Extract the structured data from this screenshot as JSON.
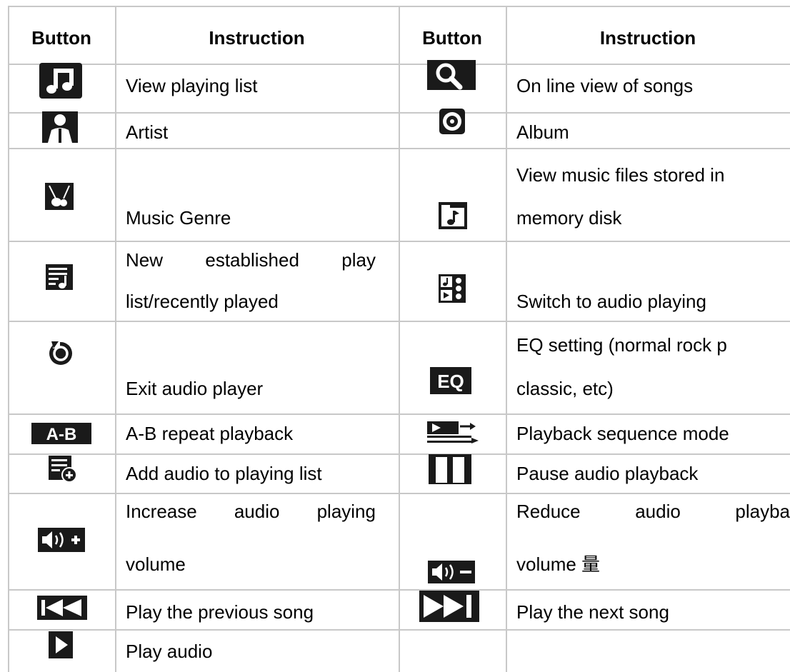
{
  "table": {
    "headers": [
      "Button",
      "Instruction",
      "Button",
      "Instruction"
    ],
    "left": [
      {
        "icon": "music-note-icon",
        "lines": [
          "View playing list"
        ]
      },
      {
        "icon": "artist-icon",
        "lines": [
          "Artist"
        ]
      },
      {
        "icon": "guitar-genre-icon",
        "lines": [
          "Music Genre"
        ]
      },
      {
        "icon": "playlist-new-icon",
        "lines": [
          "New established play",
          "list/recently played"
        ]
      },
      {
        "icon": "exit-icon",
        "lines": [
          "Exit audio player"
        ]
      },
      {
        "icon": "ab-repeat-icon",
        "lines": [
          "A-B repeat playback"
        ]
      },
      {
        "icon": "add-to-list-icon",
        "lines": [
          "Add audio to playing list"
        ]
      },
      {
        "icon": "volume-up-icon",
        "lines": [
          "Increase audio playing",
          "volume"
        ]
      },
      {
        "icon": "previous-icon",
        "lines": [
          "Play the previous song"
        ]
      },
      {
        "icon": "play-icon",
        "lines": [
          "Play audio"
        ]
      }
    ],
    "right": [
      {
        "icon": "search-icon",
        "lines": [
          "On line view of songs"
        ]
      },
      {
        "icon": "album-disc-icon",
        "lines": [
          "Album"
        ]
      },
      {
        "icon": "memory-disk-music-icon",
        "lines": [
          "View music files stored in",
          "memory disk"
        ]
      },
      {
        "icon": "switch-audio-icon",
        "lines": [
          "Switch to audio playing"
        ]
      },
      {
        "icon": "eq-icon",
        "lines": [
          "EQ setting (normal rock p",
          "classic, etc)"
        ]
      },
      {
        "icon": "sequence-mode-icon",
        "lines": [
          "Playback sequence mode"
        ]
      },
      {
        "icon": "pause-icon",
        "lines": [
          "Pause audio playback"
        ]
      },
      {
        "icon": "volume-down-icon",
        "lines": [
          "Reduce audio playba",
          "volume 量"
        ]
      },
      {
        "icon": "next-icon",
        "lines": [
          "Play the next song"
        ]
      }
    ],
    "icon_labels": {
      "ab": "A-B",
      "eq": "EQ"
    }
  },
  "colors": {
    "grid": "#c8c8c8",
    "icon_fill": "#1a1a1a"
  }
}
